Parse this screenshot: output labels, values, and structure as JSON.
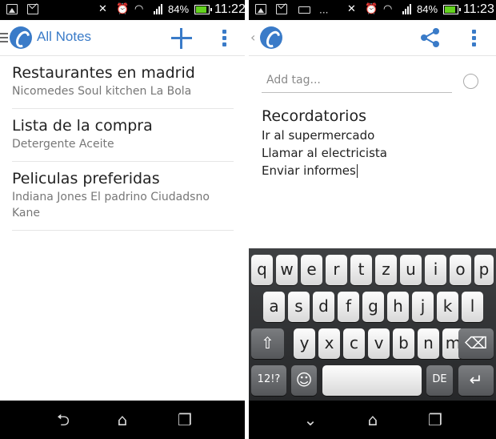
{
  "left_screen": {
    "status_bar": {
      "battery": "84%",
      "time": "11:22"
    },
    "app_bar": {
      "title": "All Notes"
    },
    "notes": [
      {
        "title": "Restaurantes en madrid",
        "preview": "Nicomedes Soul kitchen La Bola"
      },
      {
        "title": "Lista de la compra",
        "preview": "Detergente Aceite"
      },
      {
        "title": "Peliculas preferidas",
        "preview": "Indiana Jones El padrino Ciudadsno Kane"
      }
    ]
  },
  "right_screen": {
    "status_bar": {
      "battery": "84%",
      "time": "11:23"
    },
    "tag_field": {
      "placeholder": "Add tag..."
    },
    "note": {
      "title": "Recordatorios",
      "lines": [
        "Ir al supermercado",
        "Llamar al electricista",
        "Enviar informes"
      ]
    },
    "keyboard": {
      "row1": [
        "q",
        "w",
        "e",
        "r",
        "t",
        "z",
        "u",
        "i",
        "o",
        "p"
      ],
      "row2": [
        "a",
        "s",
        "d",
        "f",
        "g",
        "h",
        "j",
        "k",
        "l"
      ],
      "row3": [
        "y",
        "x",
        "c",
        "v",
        "b",
        "n",
        "m"
      ],
      "symbols_key": "12!?",
      "language_key": "DE"
    }
  },
  "icons": {
    "accent_color": "#3a7bc8",
    "battery_color": "#63d21e"
  }
}
